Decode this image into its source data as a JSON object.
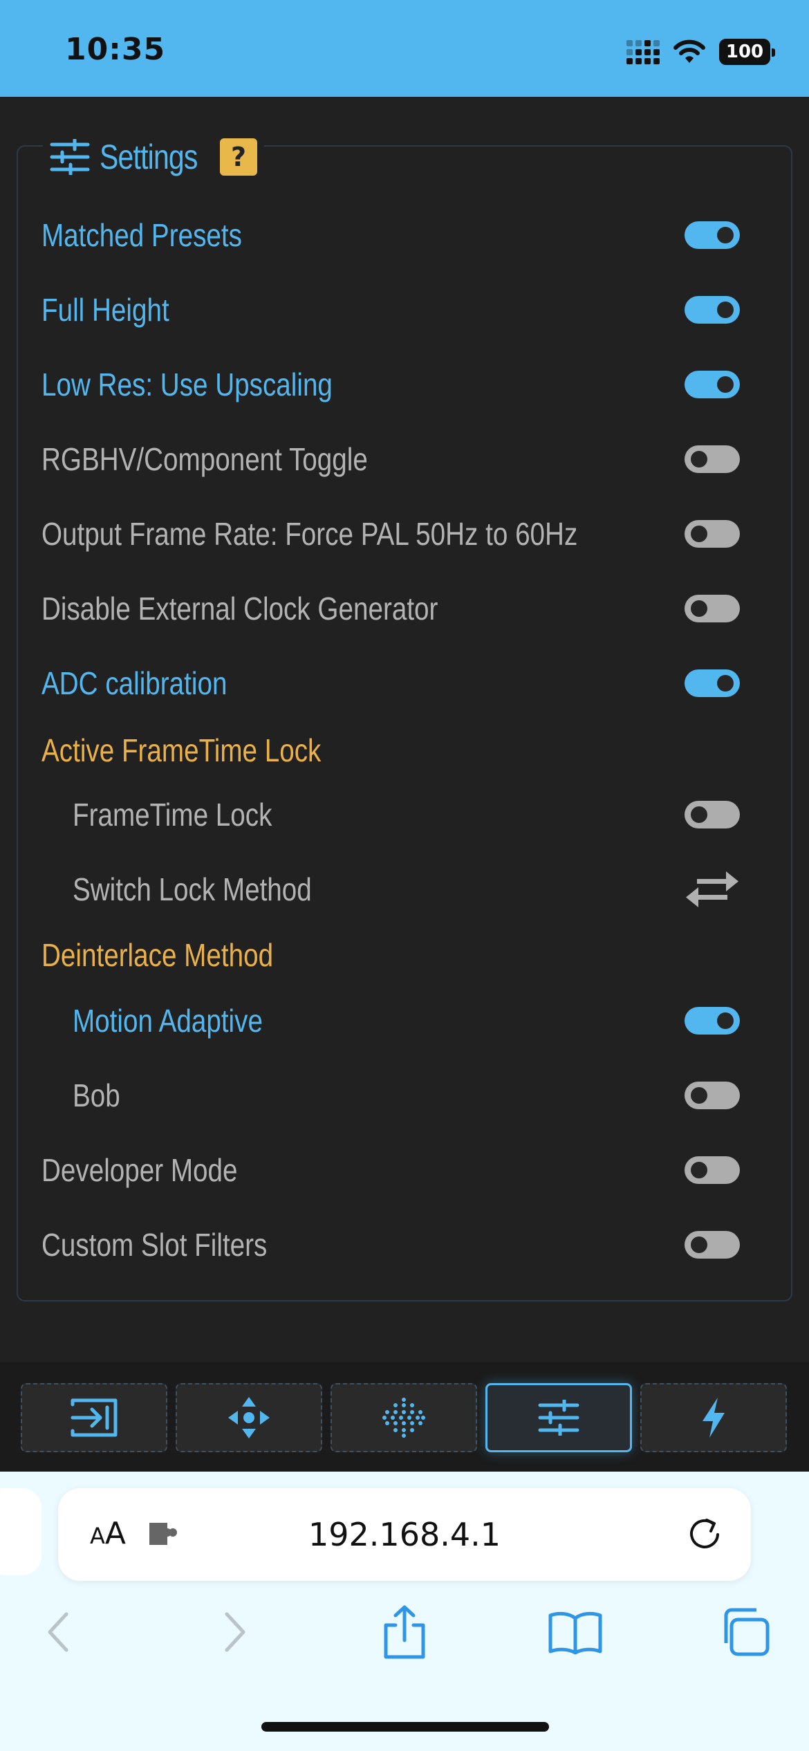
{
  "status_bar": {
    "time": "10:35",
    "battery": "100"
  },
  "panel": {
    "title": "Settings",
    "help_label": "?",
    "rows": [
      {
        "label": "Matched Presets",
        "on": true
      },
      {
        "label": "Full Height",
        "on": true
      },
      {
        "label": "Low Res: Use Upscaling",
        "on": true
      },
      {
        "label": "RGBHV/Component Toggle",
        "on": false
      },
      {
        "label": "Output Frame Rate: Force PAL 50Hz to 60Hz",
        "on": false
      },
      {
        "label": "Disable External Clock Generator",
        "on": false
      },
      {
        "label": "ADC calibration",
        "on": true
      }
    ],
    "frametime_section": {
      "title": "Active FrameTime Lock",
      "lock_label": "FrameTime Lock",
      "lock_on": false,
      "switch_label": "Switch Lock Method"
    },
    "deinterlace_section": {
      "title": "Deinterlace Method",
      "options": [
        {
          "label": "Motion Adaptive",
          "on": true
        },
        {
          "label": "Bob",
          "on": false
        }
      ]
    },
    "tail_rows": [
      {
        "label": "Developer Mode",
        "on": false
      },
      {
        "label": "Custom Slot Filters",
        "on": false
      }
    ]
  },
  "bottom_nav": {
    "active_index": 3,
    "icons": [
      "input-icon",
      "move-icon",
      "filters-icon",
      "sliders-icon",
      "bolt-icon"
    ]
  },
  "safari": {
    "aa_small": "A",
    "aa_big": "A",
    "url": "192.168.4.1"
  },
  "colors": {
    "accent": "#52b6ef",
    "section": "#eab04a",
    "background": "#212121"
  }
}
